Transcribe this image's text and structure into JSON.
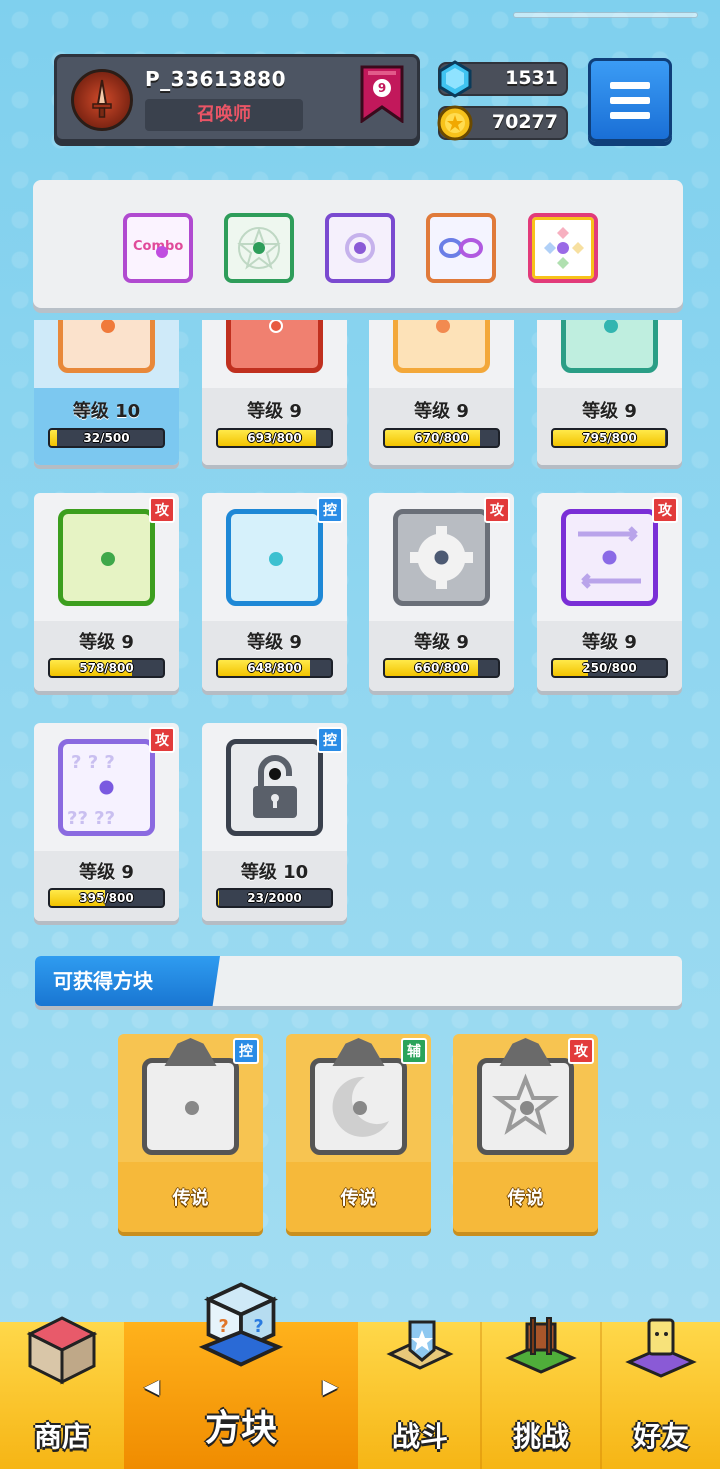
{
  "profile": {
    "name": "P_33613880",
    "title": "召唤师",
    "rank": "9"
  },
  "currency": {
    "gems": "1531",
    "coins": "70277"
  },
  "deck": {
    "slots": [
      {
        "name": "combo",
        "accent": "#c04de0",
        "text": "Combo"
      },
      {
        "name": "pentagram",
        "accent": "#2e9d5a",
        "text": ""
      },
      {
        "name": "purple-spin",
        "accent": "#8a5ad6",
        "text": ""
      },
      {
        "name": "infinity",
        "accent": "#6a7ee6",
        "text": ""
      },
      {
        "name": "rainbow",
        "accent": "#9a6ae6",
        "text": ""
      }
    ]
  },
  "cards_row1": [
    {
      "level": "等级 10",
      "progress": "32/500",
      "fill": 0.064,
      "color": "#f5a56a",
      "dot": "#f07a3a",
      "selected": true
    },
    {
      "level": "等级 9",
      "progress": "693/800",
      "fill": 0.866,
      "color": "#e0503a",
      "dot": "#e85a40",
      "selected": false
    },
    {
      "level": "等级 9",
      "progress": "670/800",
      "fill": 0.838,
      "color": "#f7c46a",
      "dot": "#f28a50",
      "selected": false
    },
    {
      "level": "等级 9",
      "progress": "795/800",
      "fill": 0.994,
      "color": "#3fbfa3",
      "dot": "#33b5b0",
      "selected": false
    }
  ],
  "cards_row2": [
    {
      "level": "等级 9",
      "progress": "578/800",
      "fill": 0.7225,
      "color": "#5fbf3a",
      "dot": "#3fa84a",
      "tag": "攻",
      "tagType": "atk"
    },
    {
      "level": "等级 9",
      "progress": "648/800",
      "fill": 0.81,
      "color": "#2aa0e0",
      "dot": "#3cc0d0",
      "tag": "控",
      "tagType": "ctl"
    },
    {
      "level": "等级 9",
      "progress": "660/800",
      "fill": 0.825,
      "color": "#777d86",
      "dot": "#4d5a73",
      "tag": "攻",
      "tagType": "atk"
    },
    {
      "level": "等级 9",
      "progress": "250/800",
      "fill": 0.3125,
      "color": "#8a4ae0",
      "dot": "#8a6ae6",
      "tag": "攻",
      "tagType": "atk"
    }
  ],
  "cards_row3": [
    {
      "level": "等级 9",
      "progress": "395/800",
      "fill": 0.49,
      "color": "#9a7ee6",
      "dot": "#7a5ae0",
      "tag": "攻",
      "tagType": "atk"
    },
    {
      "level": "等级 10",
      "progress": "23/2000",
      "fill": 0.0115,
      "color": "#3a414d",
      "dot": "#222",
      "tag": "控",
      "tagType": "ctl",
      "locked": true
    }
  ],
  "obtainable": {
    "title": "可获得方块",
    "cards": [
      {
        "rarity": "传说",
        "tag": "控",
        "tagType": "ctl"
      },
      {
        "rarity": "传说",
        "tag": "辅",
        "tagType": "sup"
      },
      {
        "rarity": "传说",
        "tag": "攻",
        "tagType": "atk"
      }
    ]
  },
  "nav": {
    "shop": "商店",
    "blocks": "方块",
    "battle": "战斗",
    "challenge": "挑战",
    "friends": "好友",
    "left_arrow": "◀",
    "right_arrow": "▶"
  }
}
